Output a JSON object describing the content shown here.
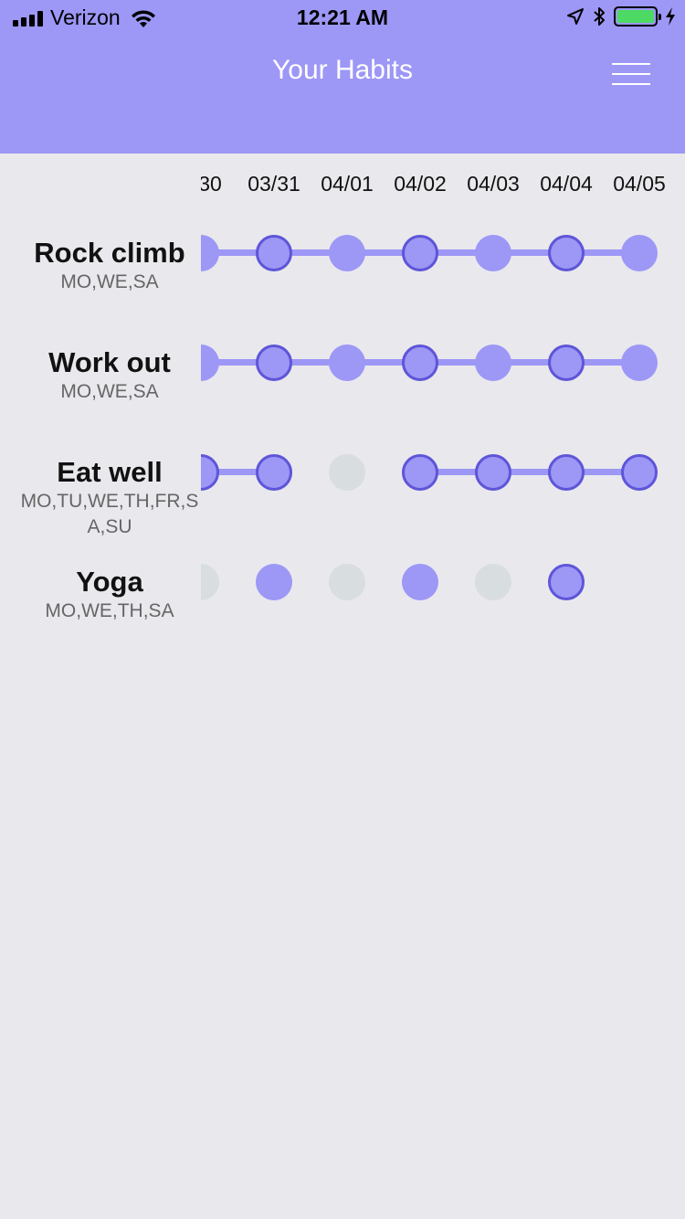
{
  "status_bar": {
    "carrier": "Verizon",
    "time": "12:21 AM",
    "battery_level": 1.0
  },
  "header": {
    "title": "Your Habits",
    "menu_icon": "hamburger-menu-icon"
  },
  "colors": {
    "header_bg": "#9d97f6",
    "accent": "#9d97f6",
    "ring": "#5e55d8",
    "missed": "#d8dde0",
    "background": "#e9e8ed"
  },
  "dates": [
    "30",
    "03/31",
    "04/01",
    "04/02",
    "04/03",
    "04/04",
    "04/05"
  ],
  "habits": [
    {
      "name": "Rock climb",
      "days": "MO,WE,SA",
      "cells": [
        "done",
        "ring",
        "done",
        "ring",
        "done",
        "ring",
        "done"
      ],
      "links": [
        true,
        true,
        true,
        true,
        true,
        true
      ]
    },
    {
      "name": "Work out",
      "days": "MO,WE,SA",
      "cells": [
        "done",
        "ring",
        "done",
        "ring",
        "done",
        "ring",
        "done"
      ],
      "links": [
        true,
        true,
        true,
        true,
        true,
        true
      ]
    },
    {
      "name": "Eat well",
      "days": "MO,TU,WE,TH,FR,SA,SU",
      "cells": [
        "ring",
        "ring",
        "miss",
        "ring",
        "ring",
        "ring",
        "ring"
      ],
      "links": [
        true,
        false,
        false,
        true,
        true,
        true
      ]
    },
    {
      "name": "Yoga",
      "days": "MO,WE,TH,SA",
      "cells": [
        "miss",
        "done",
        "miss",
        "done",
        "miss",
        "ring",
        "none"
      ],
      "links": [
        false,
        false,
        false,
        false,
        false,
        false
      ]
    }
  ]
}
